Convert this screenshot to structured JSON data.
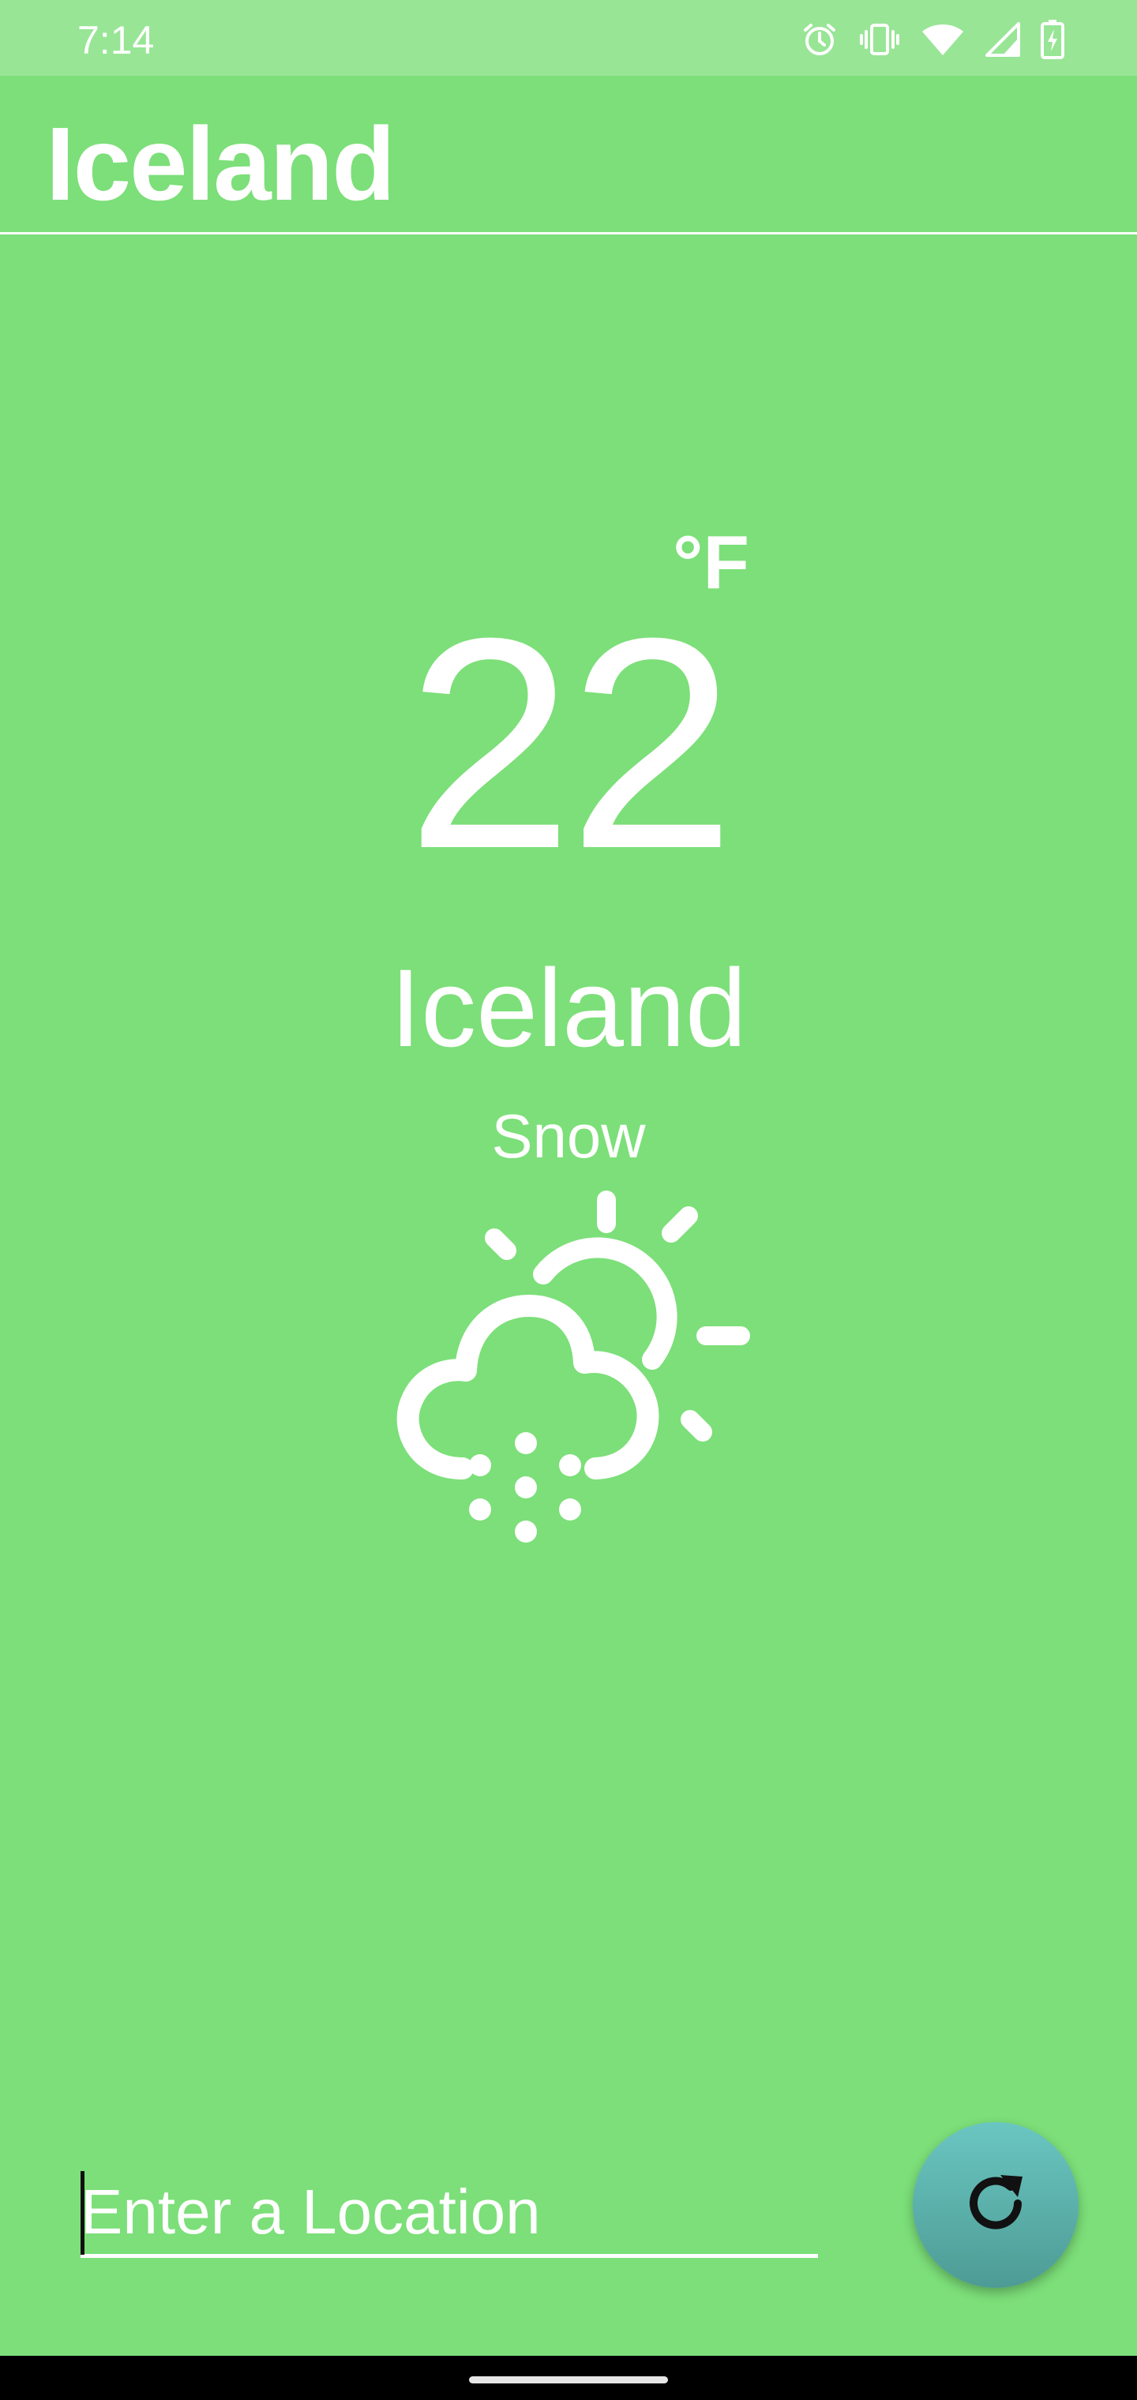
{
  "status_bar": {
    "time": "7:14",
    "icons": [
      "alarm-icon",
      "vibrate-icon",
      "wifi-icon",
      "cellular-signal-icon",
      "battery-charging-icon"
    ]
  },
  "app_bar": {
    "title": "Iceland"
  },
  "weather": {
    "unit": "°F",
    "temperature": "22",
    "location": "Iceland",
    "condition": "Snow",
    "icon": "snow-partly-sunny-icon"
  },
  "location_input": {
    "placeholder": "Enter a Location",
    "value": ""
  },
  "refresh_button": {
    "icon": "refresh-icon"
  },
  "colors": {
    "background": "#7cdf79",
    "status_bar": "#98e596",
    "text": "#ffffff",
    "fab": "#5cb1ab"
  }
}
